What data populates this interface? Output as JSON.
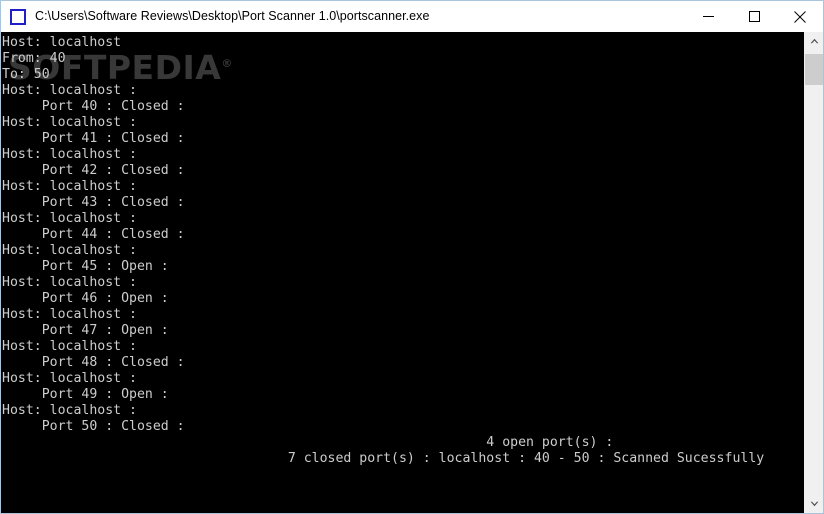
{
  "window": {
    "title": "C:\\Users\\Software Reviews\\Desktop\\Port Scanner 1.0\\portscanner.exe",
    "icon": "console-window-icon",
    "controls": {
      "minimize_label": "Minimize",
      "maximize_label": "Maximize",
      "close_label": "Close"
    }
  },
  "watermark": {
    "text": "SOFTPEDIA",
    "registered_mark": "®",
    "color": "#383838"
  },
  "console": {
    "background_color": "#000000",
    "text_color": "#cccccc",
    "lines": [
      "Host: localhost",
      "From: 40",
      "To: 50",
      "Host: localhost :",
      "     Port 40 : Closed :",
      "Host: localhost :",
      "     Port 41 : Closed :",
      "Host: localhost :",
      "     Port 42 : Closed :",
      "Host: localhost :",
      "     Port 43 : Closed :",
      "Host: localhost :",
      "     Port 44 : Closed :",
      "Host: localhost :",
      "     Port 45 : Open :",
      "Host: localhost :",
      "     Port 46 : Open :",
      "Host: localhost :",
      "     Port 47 : Open :",
      "Host: localhost :",
      "     Port 48 : Closed :",
      "Host: localhost :",
      "     Port 49 : Open :",
      "Host: localhost :",
      "     Port 50 : Closed :",
      "                                                             4 open port(s) :",
      "                                    7 closed port(s) : localhost : 40 - 50 : Scanned Sucessfully"
    ],
    "scan": {
      "host": "localhost",
      "port_from": "40",
      "port_to": "50",
      "open_count": "4",
      "closed_count": "7",
      "status": "Scanned Sucessfully"
    }
  },
  "scrollbar": {
    "up_arrow": "scroll-up-arrow",
    "down_arrow": "scroll-down-arrow",
    "thumb_label": "scroll-thumb"
  }
}
